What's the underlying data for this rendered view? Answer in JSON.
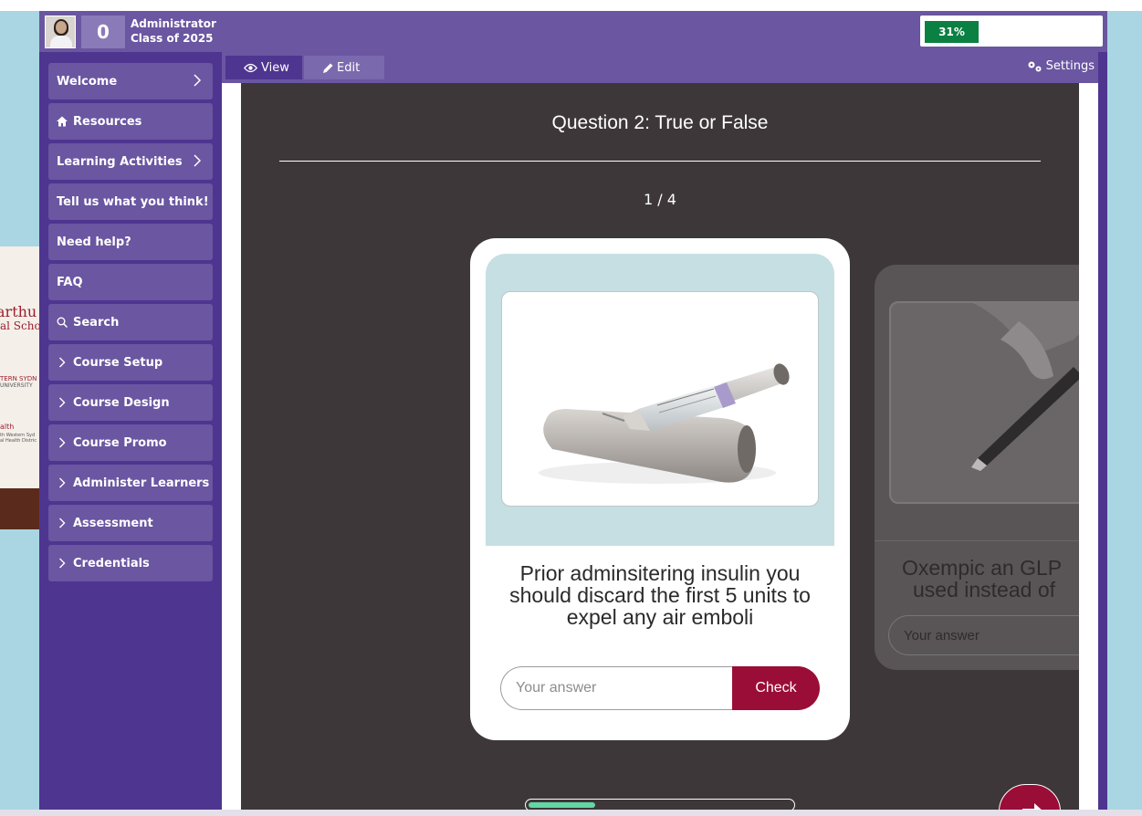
{
  "header": {
    "points": "0",
    "user_name": "Administrator",
    "user_class": "Class of 2025",
    "progress_value": 0.31,
    "progress_label": "31%"
  },
  "sidebar": {
    "items": [
      {
        "label": "Welcome"
      },
      {
        "label": "Resources"
      },
      {
        "label": "Learning Activities"
      },
      {
        "label": "Tell us what you think!"
      },
      {
        "label": "Need help?"
      },
      {
        "label": "FAQ"
      },
      {
        "label": "Search"
      },
      {
        "label": "Course Setup"
      },
      {
        "label": "Course Design"
      },
      {
        "label": "Course Promo"
      },
      {
        "label": "Administer Learners"
      },
      {
        "label": "Assessment"
      },
      {
        "label": "Credentials"
      }
    ]
  },
  "tabs": {
    "view": "View",
    "edit": "Edit",
    "settings": "Settings"
  },
  "quiz": {
    "title": "Question 2: True or False",
    "counter": "1 / 4",
    "current_card": {
      "question": "Prior adminsitering insulin you should discard the first 5 units to expel any air emboli",
      "answer_placeholder": "Your answer",
      "check_label": "Check"
    },
    "next_card": {
      "question_line1": "Oxempic an GLP",
      "question_line2": "used instead of",
      "answer_placeholder": "Your answer"
    },
    "pager_progress": 0.25
  },
  "background": {
    "sign_line1": "arthu",
    "sign_line2": "al Schoo",
    "sign_line3": "TERN SYDN",
    "sign_line4": "UNIVERSITY",
    "sign_line5": "alth",
    "sign_line6": "th Western Syd",
    "sign_line7": "al Health Distric"
  },
  "colors": {
    "primary_purple": "#6a56a1",
    "dark_purple": "#4e3590",
    "progress_green": "#0b8043",
    "check_red": "#9a0d37",
    "stage_bg": "#3d3739"
  }
}
